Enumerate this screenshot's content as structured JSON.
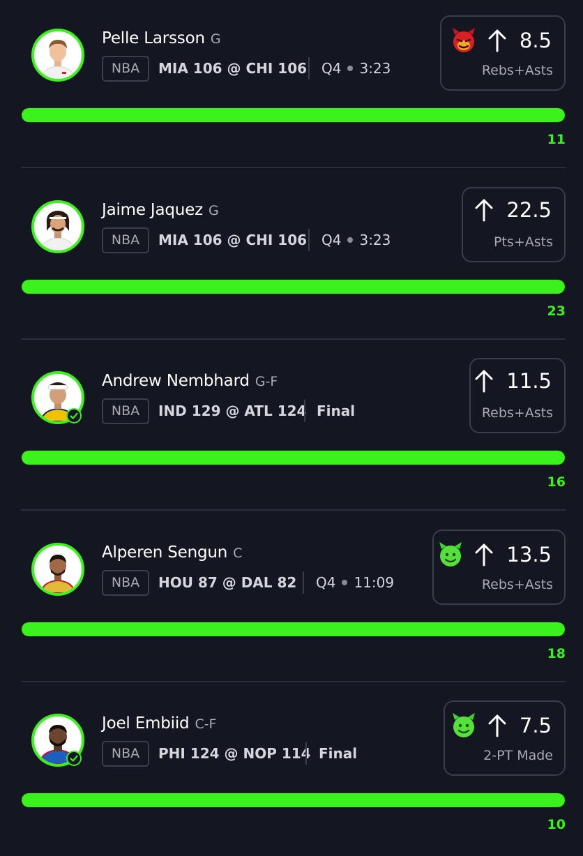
{
  "colors": {
    "background": "#141621",
    "accent_green": "#3bf21d",
    "border": "#3a3d4a",
    "text_primary": "#ffffff",
    "text_secondary": "#a9aab2"
  },
  "picks": [
    {
      "player_name": "Pelle Larsson",
      "position": "G",
      "league": "NBA",
      "matchup": "MIA 106 @ CHI 106",
      "status": {
        "period": "Q4",
        "clock": "3:23",
        "final": ""
      },
      "completed": false,
      "direction_icon": "arrow-up-icon",
      "line": "8.5",
      "stat_type": "Rebs+Asts",
      "emoji": "red-devil-emoji",
      "result": "11",
      "progress": 1.0
    },
    {
      "player_name": "Jaime Jaquez",
      "position": "G",
      "league": "NBA",
      "matchup": "MIA 106 @ CHI 106",
      "status": {
        "period": "Q4",
        "clock": "3:23",
        "final": ""
      },
      "completed": false,
      "direction_icon": "arrow-up-icon",
      "line": "22.5",
      "stat_type": "Pts+Asts",
      "emoji": "",
      "result": "23",
      "progress": 1.0
    },
    {
      "player_name": "Andrew Nembhard",
      "position": "G-F",
      "league": "NBA",
      "matchup": "IND 129 @ ATL 124",
      "status": {
        "period": "",
        "clock": "",
        "final": "Final"
      },
      "completed": true,
      "direction_icon": "arrow-up-icon",
      "line": "11.5",
      "stat_type": "Rebs+Asts",
      "emoji": "",
      "result": "16",
      "progress": 1.0
    },
    {
      "player_name": "Alperen Sengun",
      "position": "C",
      "league": "NBA",
      "matchup": "HOU 87 @ DAL 82",
      "status": {
        "period": "Q4",
        "clock": "11:09",
        "final": ""
      },
      "completed": false,
      "direction_icon": "arrow-up-icon",
      "line": "13.5",
      "stat_type": "Rebs+Asts",
      "emoji": "green-devil-emoji",
      "result": "18",
      "progress": 1.0
    },
    {
      "player_name": "Joel Embiid",
      "position": "C-F",
      "league": "NBA",
      "matchup": "PHI 124 @ NOP 114",
      "status": {
        "period": "",
        "clock": "",
        "final": "Final"
      },
      "completed": true,
      "direction_icon": "arrow-up-icon",
      "line": "7.5",
      "stat_type": "2-PT Made",
      "emoji": "green-devil-emoji",
      "result": "10",
      "progress": 1.0
    }
  ]
}
